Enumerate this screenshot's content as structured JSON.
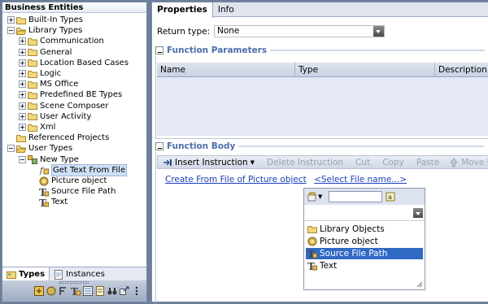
{
  "left_panel": {
    "title": "Business Entities",
    "tree": [
      {
        "label": "Built-In Types",
        "indent": 0,
        "toggle": "plus",
        "icon": "folder-icon"
      },
      {
        "label": "Library Types",
        "indent": 0,
        "toggle": "minus",
        "icon": "folder-open-icon"
      },
      {
        "label": "Communication",
        "indent": 1,
        "toggle": "plus",
        "icon": "folder-icon"
      },
      {
        "label": "General",
        "indent": 1,
        "toggle": "plus",
        "icon": "folder-icon"
      },
      {
        "label": "Location Based Cases",
        "indent": 1,
        "toggle": "plus",
        "icon": "folder-icon"
      },
      {
        "label": "Logic",
        "indent": 1,
        "toggle": "plus",
        "icon": "folder-icon"
      },
      {
        "label": "MS Office",
        "indent": 1,
        "toggle": "plus",
        "icon": "folder-icon"
      },
      {
        "label": "Predefined BE Types",
        "indent": 1,
        "toggle": "plus",
        "icon": "folder-icon"
      },
      {
        "label": "Scene Composer",
        "indent": 1,
        "toggle": "plus",
        "icon": "folder-icon"
      },
      {
        "label": "User Activity",
        "indent": 1,
        "toggle": "plus",
        "icon": "folder-icon"
      },
      {
        "label": "Xml",
        "indent": 1,
        "toggle": "plus",
        "icon": "folder-icon"
      },
      {
        "label": "Referenced Projects",
        "indent": 0,
        "toggle": "none",
        "icon": "folder-icon"
      },
      {
        "label": "User Types",
        "indent": 0,
        "toggle": "minus",
        "icon": "folder-open-icon"
      },
      {
        "label": "New Type",
        "indent": 1,
        "toggle": "minus",
        "icon": "type-group-icon"
      },
      {
        "label": "Get Text From File",
        "indent": 2,
        "toggle": "none",
        "icon": "function-icon",
        "selected": true
      },
      {
        "label": "Picture object",
        "indent": 2,
        "toggle": "none",
        "icon": "object-icon"
      },
      {
        "label": "Source File Path",
        "indent": 2,
        "toggle": "none",
        "icon": "text-type-icon"
      },
      {
        "label": "Text",
        "indent": 2,
        "toggle": "none",
        "icon": "text-type-icon"
      }
    ],
    "tabs": [
      {
        "label": "Types",
        "icon": "types-icon",
        "active": true
      },
      {
        "label": "Instances",
        "icon": "instances-icon",
        "active": false
      }
    ],
    "toolbar_icons": [
      "new-type-icon",
      "new-object-icon",
      "new-function-icon",
      "text-type-icon",
      "list-icon",
      "document-icon",
      "binoculars-icon",
      "share-icon",
      "more-icon"
    ]
  },
  "right_panel": {
    "tabs": [
      {
        "label": "Properties",
        "active": true
      },
      {
        "label": "Info",
        "active": false
      }
    ],
    "return_type": {
      "label": "Return type:",
      "value": "None"
    },
    "params": {
      "title": "Function Parameters",
      "columns": [
        "Name",
        "Type",
        "Description"
      ]
    },
    "body": {
      "title": "Function Body",
      "toolbar": [
        {
          "label": "Insert Instruction",
          "icon": "insert-icon",
          "caret": true,
          "disabled": false
        },
        {
          "label": "Delete Instruction",
          "disabled": true
        },
        {
          "label": "Cut",
          "disabled": true
        },
        {
          "label": "Copy",
          "disabled": true
        },
        {
          "label": "Paste",
          "disabled": true
        },
        {
          "label": "Move U",
          "icon": "move-icon",
          "disabled": true
        }
      ],
      "sentence_link": "Create From File of Picture object",
      "sentence_selector": "<Select File name...>"
    },
    "popup": {
      "items": [
        {
          "label": "Library Objects",
          "icon": "folder-icon",
          "highlight": false
        },
        {
          "label": "Picture object",
          "icon": "object-icon",
          "highlight": false
        },
        {
          "label": "Source File Path",
          "icon": "text-type-icon",
          "highlight": true
        },
        {
          "label": "Text",
          "icon": "text-type-icon",
          "highlight": false
        }
      ]
    }
  }
}
